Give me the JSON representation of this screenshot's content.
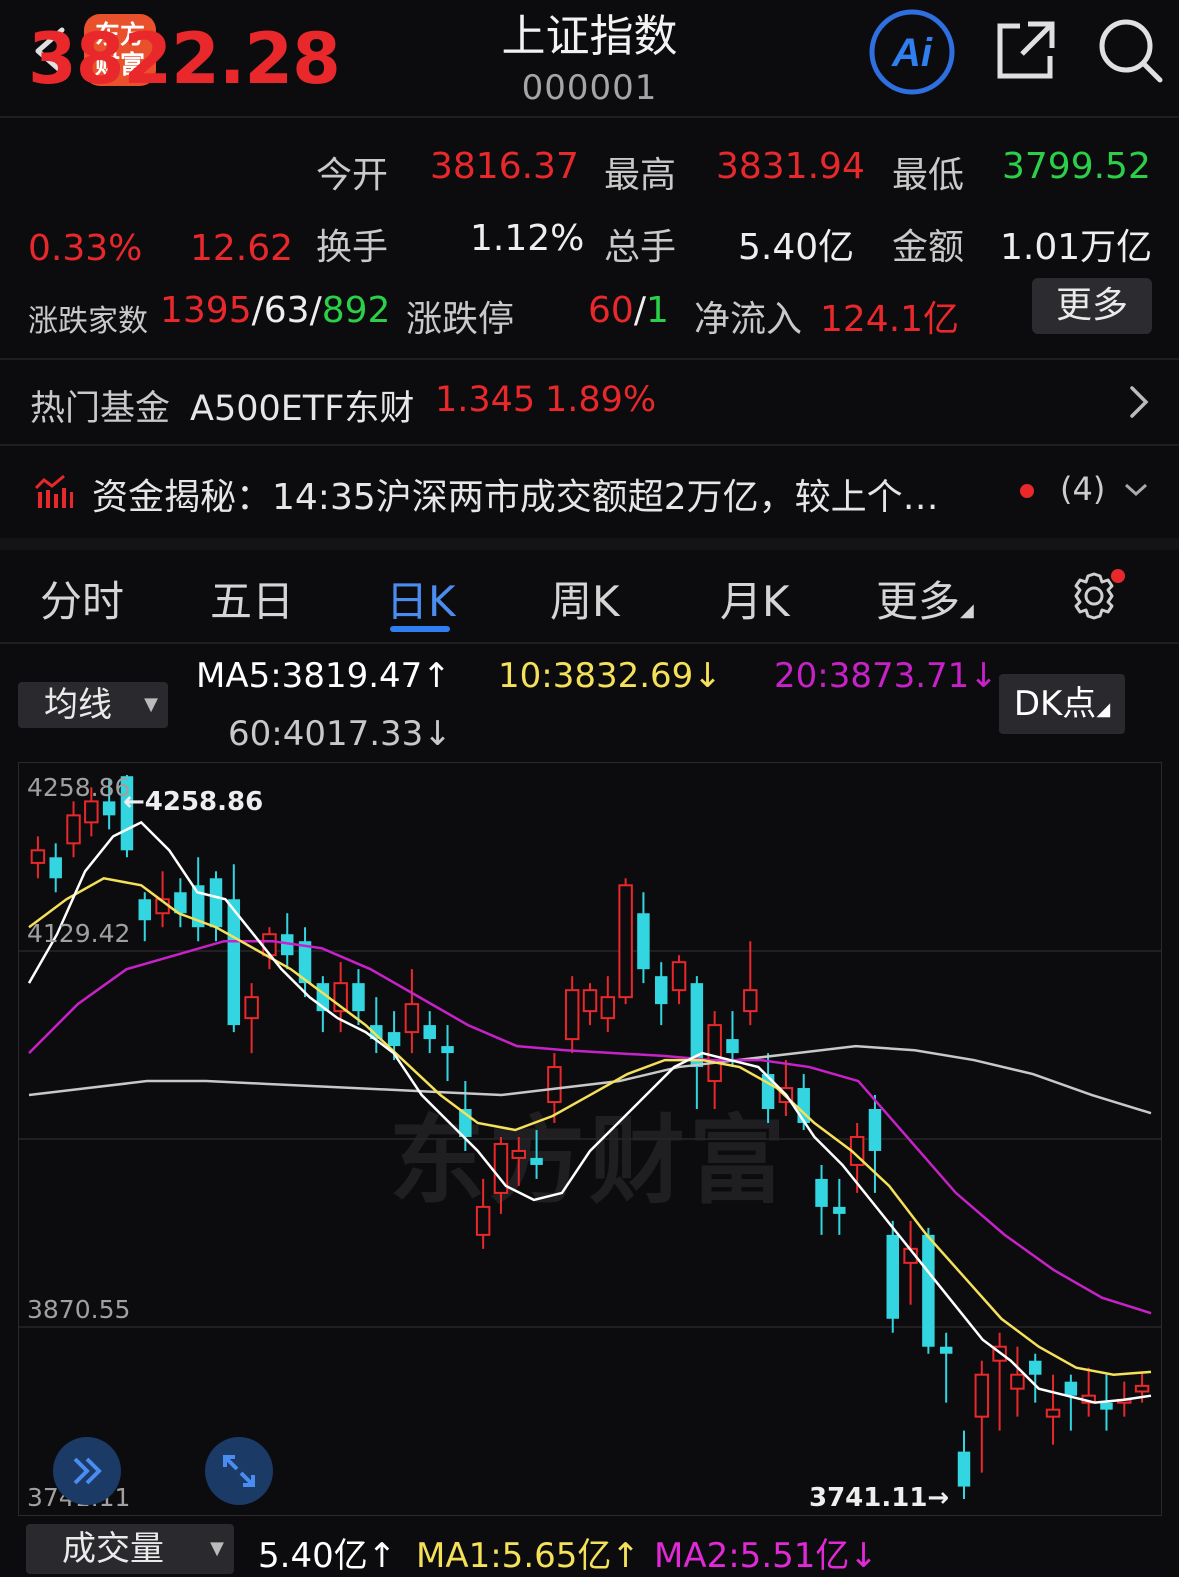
{
  "header": {
    "title": "上证指数",
    "code": "000001",
    "logo_line1": "东方",
    "logo_line2": "财富",
    "ai_label": "Ai"
  },
  "quote": {
    "price": "3822.28",
    "change_pct": "0.33%",
    "change_abs": "12.62",
    "open_label": "今开",
    "open": "3816.37",
    "high_label": "最高",
    "high": "3831.94",
    "low_label": "最低",
    "low": "3799.52",
    "turnover_label": "换手",
    "turnover": "1.12%",
    "volume_label": "总手",
    "volume": "5.40亿",
    "amount_label": "金额",
    "amount": "1.01万亿",
    "breadth_label": "涨跌家数",
    "breadth_up": "1395",
    "breadth_flat": "63",
    "breadth_down": "892",
    "limit_label": "涨跌停",
    "limit_up": "60",
    "limit_down": "1",
    "inflow_label": "净流入",
    "inflow": "124.1亿",
    "more": "更多"
  },
  "fund": {
    "label": "热门基金",
    "name": "A500ETF东财",
    "price": "1.345",
    "pct": "1.89%"
  },
  "news": {
    "text": "资金揭秘：14:35沪深两市成交额超2万亿，较上个…",
    "count": "(4)"
  },
  "tabs": [
    "分时",
    "五日",
    "日K",
    "周K",
    "月K",
    "更多"
  ],
  "active_tab": "日K",
  "ma": {
    "select": "均线",
    "ma5": "MA5:3819.47↑",
    "ma10": "10:3832.69↓",
    "ma20": "20:3873.71↓",
    "ma60": "60:4017.33↓",
    "dk": "DK点"
  },
  "volume_bar": {
    "select": "成交量",
    "vol": "5.40亿↑",
    "ma1": "MA1:5.65亿↑",
    "ma2": "MA2:5.51亿↓"
  },
  "colors": {
    "up": "#e8282b",
    "down": "#2bd048",
    "candle_down": "#33d6e0",
    "ma5": "#ffffff",
    "ma10": "#f5e05a",
    "ma20": "#c622c8",
    "ma60": "#c8c8c8",
    "accent": "#2f7ff0"
  },
  "chart_data": {
    "type": "candlestick",
    "y_ticks": [
      "4258.86",
      "4129.42",
      "3870.55",
      "3741.11"
    ],
    "high_marker": "←4258.86",
    "low_marker": "3741.11→",
    "ylim": [
      3741.11,
      4258.86
    ],
    "candles": [
      [
        4196,
        4205,
        4185,
        4215
      ],
      [
        4200,
        4185,
        4175,
        4210
      ],
      [
        4210,
        4230,
        4200,
        4240
      ],
      [
        4225,
        4240,
        4215,
        4250
      ],
      [
        4240,
        4230,
        4220,
        4255
      ],
      [
        4258,
        4205,
        4200,
        4258.86
      ],
      [
        4170,
        4155,
        4140,
        4175
      ],
      [
        4160,
        4170,
        4150,
        4190
      ],
      [
        4175,
        4160,
        4150,
        4185
      ],
      [
        4180,
        4150,
        4140,
        4200
      ],
      [
        4185,
        4150,
        4140,
        4190
      ],
      [
        4170,
        4080,
        4075,
        4195
      ],
      [
        4085,
        4100,
        4060,
        4110
      ],
      [
        4130,
        4145,
        4120,
        4150
      ],
      [
        4145,
        4130,
        4120,
        4160
      ],
      [
        4140,
        4110,
        4100,
        4150
      ],
      [
        4110,
        4090,
        4075,
        4115
      ],
      [
        4090,
        4110,
        4075,
        4125
      ],
      [
        4110,
        4090,
        4080,
        4120
      ],
      [
        4080,
        4070,
        4060,
        4100
      ],
      [
        4075,
        4065,
        4055,
        4090
      ],
      [
        4075,
        4095,
        4060,
        4120
      ],
      [
        4080,
        4070,
        4060,
        4090
      ],
      [
        4065,
        4060,
        4040,
        4080
      ],
      [
        4020,
        4000,
        3990,
        4040
      ],
      [
        3930,
        3950,
        3920,
        3970
      ],
      [
        3960,
        3995,
        3945,
        4000
      ],
      [
        3985,
        3990,
        3965,
        4000
      ],
      [
        3985,
        3980,
        3970,
        4005
      ],
      [
        4025,
        4050,
        4010,
        4060
      ],
      [
        4070,
        4105,
        4060,
        4115
      ],
      [
        4090,
        4105,
        4080,
        4110
      ],
      [
        4085,
        4100,
        4075,
        4115
      ],
      [
        4100,
        4180,
        4095,
        4185
      ],
      [
        4160,
        4120,
        4110,
        4175
      ],
      [
        4115,
        4095,
        4080,
        4125
      ],
      [
        4105,
        4125,
        4095,
        4130
      ],
      [
        4110,
        4050,
        4020,
        4115
      ],
      [
        4040,
        4080,
        4020,
        4090
      ],
      [
        4070,
        4060,
        4050,
        4090
      ],
      [
        4090,
        4105,
        4080,
        4140
      ],
      [
        4045,
        4020,
        4010,
        4060
      ],
      [
        4025,
        4035,
        4015,
        4055
      ],
      [
        4035,
        4010,
        4005,
        4045
      ],
      [
        3970,
        3950,
        3930,
        3980
      ],
      [
        3950,
        3945,
        3930,
        3970
      ],
      [
        3980,
        4000,
        3960,
        4010
      ],
      [
        4020,
        3990,
        3960,
        4030
      ],
      [
        3930,
        3870,
        3860,
        3940
      ],
      [
        3910,
        3920,
        3880,
        3940
      ],
      [
        3930,
        3850,
        3845,
        3935
      ],
      [
        3850,
        3845,
        3810,
        3860
      ],
      [
        3775,
        3750,
        3741.11,
        3790
      ],
      [
        3800,
        3830,
        3760,
        3840
      ],
      [
        3840,
        3850,
        3790,
        3860
      ],
      [
        3820,
        3830,
        3800,
        3850
      ],
      [
        3840,
        3830,
        3810,
        3845
      ],
      [
        3800,
        3805,
        3780,
        3830
      ],
      [
        3825,
        3815,
        3790,
        3830
      ],
      [
        3810,
        3815,
        3800,
        3835
      ],
      [
        3810,
        3805,
        3790,
        3830
      ],
      [
        3810,
        3812,
        3800,
        3825
      ],
      [
        3818,
        3822,
        3810,
        3832
      ]
    ],
    "ma5": [
      4110,
      4145,
      4190,
      4215,
      4225,
      4205,
      4175,
      4170,
      4145,
      4120,
      4100,
      4085,
      4075,
      4060,
      4030,
      4010,
      3990,
      3965,
      3955,
      3960,
      3990,
      4010,
      4030,
      4050,
      4060,
      4055,
      4050,
      4030,
      4000,
      3980,
      3955,
      3930,
      3905,
      3880,
      3855,
      3840,
      3820,
      3815,
      3810,
      3812,
      3815
    ],
    "ma10": [
      4150,
      4170,
      4185,
      4180,
      4160,
      4150,
      4135,
      4120,
      4100,
      4080,
      4055,
      4030,
      4010,
      4005,
      4015,
      4030,
      4045,
      4055,
      4055,
      4050,
      4035,
      4010,
      3990,
      3965,
      3930,
      3900,
      3870,
      3850,
      3835,
      3830,
      3832
    ],
    "ma20": [
      4060,
      4095,
      4120,
      4130,
      4140,
      4140,
      4135,
      4120,
      4100,
      4080,
      4065,
      4062,
      4060,
      4058,
      4055,
      4055,
      4050,
      4040,
      4000,
      3960,
      3930,
      3905,
      3885,
      3874
    ],
    "ma60": [
      4030,
      4035,
      4040,
      4040,
      4038,
      4036,
      4034,
      4032,
      4030,
      4035,
      4040,
      4050,
      4055,
      4060,
      4065,
      4062,
      4055,
      4045,
      4030,
      4017
    ]
  }
}
